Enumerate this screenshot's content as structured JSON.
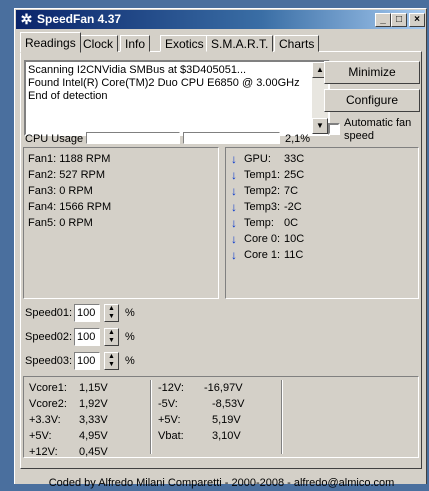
{
  "window": {
    "title": "SpeedFan 4.37",
    "minimize_glyph": "_",
    "maximize_glyph": "□",
    "close_glyph": "×",
    "app_icon": "fan-icon"
  },
  "tabs": [
    "Readings",
    "Clock",
    "Info",
    "Exotics",
    "S.M.A.R.T.",
    "Charts"
  ],
  "log": {
    "lines": [
      "Scanning I2CNVidia SMBus at $3D405051...",
      "Found Intel(R) Core(TM)2 Duo CPU E6850 @ 3.00GHz",
      "End of detection"
    ]
  },
  "buttons": {
    "minimize": "Minimize",
    "configure": "Configure"
  },
  "auto_fan": {
    "label_line1": "Automatic fan",
    "label_line2": "speed",
    "checked": false
  },
  "cpu": {
    "label": "CPU Usage",
    "percent_text": "2,1%",
    "usage": [
      0.0,
      0.0
    ]
  },
  "fans": [
    {
      "label": "Fan1:",
      "value": "1188 RPM"
    },
    {
      "label": "Fan2:",
      "value": "527 RPM"
    },
    {
      "label": "Fan3:",
      "value": "0 RPM"
    },
    {
      "label": "Fan4:",
      "value": "1566 RPM"
    },
    {
      "label": "Fan5:",
      "value": "0 RPM"
    }
  ],
  "temps": [
    {
      "label": "GPU:",
      "value": "33C",
      "trend": "down"
    },
    {
      "label": "Temp1:",
      "value": "25C",
      "trend": "down"
    },
    {
      "label": "Temp2:",
      "value": "7C",
      "trend": "down"
    },
    {
      "label": "Temp3:",
      "value": "-2C",
      "trend": "down"
    },
    {
      "label": "Temp:",
      "value": "0C",
      "trend": "down"
    },
    {
      "label": "Core 0:",
      "value": "10C",
      "trend": "down"
    },
    {
      "label": "Core 1:",
      "value": "11C",
      "trend": "down"
    }
  ],
  "speeds": [
    {
      "label": "Speed01:",
      "value": "100",
      "unit": "%"
    },
    {
      "label": "Speed02:",
      "value": "100",
      "unit": "%"
    },
    {
      "label": "Speed03:",
      "value": "100",
      "unit": "%"
    }
  ],
  "voltages_left": [
    {
      "label": "Vcore1:",
      "value": "1,15V"
    },
    {
      "label": "Vcore2:",
      "value": "1,92V"
    },
    {
      "label": "+3.3V:",
      "value": "3,33V"
    },
    {
      "label": "+5V:",
      "value": "4,95V"
    },
    {
      "label": "+12V:",
      "value": "0,45V"
    }
  ],
  "voltages_right": [
    {
      "label": "-12V:",
      "value": "-16,97V"
    },
    {
      "label": "-5V:",
      "value": "-8,53V"
    },
    {
      "label": "+5V:",
      "value": "5,19V"
    },
    {
      "label": "Vbat:",
      "value": "3,10V"
    }
  ],
  "footer": "Coded by Alfredo Milani Comparetti - 2000-2008 - alfredo@almico.com"
}
